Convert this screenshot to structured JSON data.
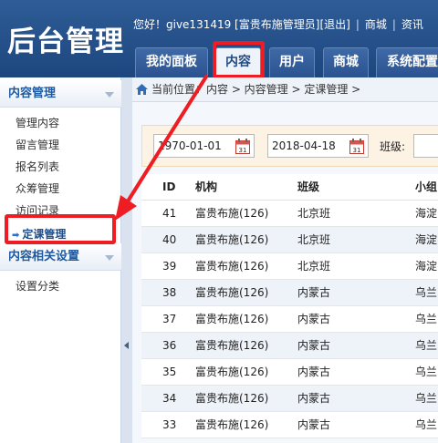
{
  "app": {
    "title": "后台管理"
  },
  "topbar": {
    "greeting": "您好！give131419 [富贵布施管理员]",
    "logout": "[退出]",
    "mall": "商城",
    "news": "资讯"
  },
  "nav": {
    "tabs": [
      {
        "label": "我的面板"
      },
      {
        "label": "内容",
        "active": true
      },
      {
        "label": "用户"
      },
      {
        "label": "商城"
      },
      {
        "label": "系统配置"
      }
    ]
  },
  "sidebar": {
    "section1_title": "内容管理",
    "items": [
      {
        "label": "管理内容"
      },
      {
        "label": "留言管理"
      },
      {
        "label": "报名列表"
      },
      {
        "label": "众筹管理"
      },
      {
        "label": "访问记录"
      },
      {
        "label": "定课管理",
        "active": true
      }
    ],
    "section2_title": "内容相关设置",
    "items2": [
      {
        "label": "设置分类"
      }
    ]
  },
  "breadcrumb": {
    "text": "当前位置：内容 > 内容管理 > 定课管理 >"
  },
  "filter": {
    "start_date": "1970-01-01",
    "end_date": "2018-04-18",
    "class_label": "班级:"
  },
  "table": {
    "headers": {
      "id": "ID",
      "org": "机构",
      "cls": "班级",
      "grp": "小组"
    },
    "rows": [
      {
        "id": "41",
        "org": "富贵布施(126)",
        "cls": "北京班",
        "grp": "海淀"
      },
      {
        "id": "40",
        "org": "富贵布施(126)",
        "cls": "北京班",
        "grp": "海淀"
      },
      {
        "id": "39",
        "org": "富贵布施(126)",
        "cls": "北京班",
        "grp": "海淀"
      },
      {
        "id": "38",
        "org": "富贵布施(126)",
        "cls": "内蒙古",
        "grp": "乌兰"
      },
      {
        "id": "37",
        "org": "富贵布施(126)",
        "cls": "内蒙古",
        "grp": "乌兰"
      },
      {
        "id": "36",
        "org": "富贵布施(126)",
        "cls": "内蒙古",
        "grp": "乌兰"
      },
      {
        "id": "35",
        "org": "富贵布施(126)",
        "cls": "内蒙古",
        "grp": "乌兰"
      },
      {
        "id": "34",
        "org": "富贵布施(126)",
        "cls": "内蒙古",
        "grp": "乌兰"
      },
      {
        "id": "33",
        "org": "富贵布施(126)",
        "cls": "内蒙古",
        "grp": "乌兰"
      }
    ]
  },
  "colors": {
    "header_blue": "#1d467e",
    "highlight_red": "#ee1d23",
    "row_alt": "#eef3f9"
  }
}
